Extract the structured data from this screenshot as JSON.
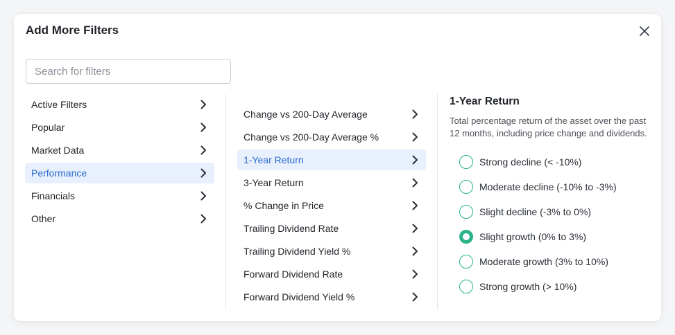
{
  "dialog": {
    "title": "Add More Filters",
    "search_placeholder": "Search for filters"
  },
  "categories": [
    {
      "label": "Active Filters",
      "selected": false
    },
    {
      "label": "Popular",
      "selected": false
    },
    {
      "label": "Market Data",
      "selected": false
    },
    {
      "label": "Performance",
      "selected": true
    },
    {
      "label": "Financials",
      "selected": false
    },
    {
      "label": "Other",
      "selected": false
    }
  ],
  "filters": [
    {
      "label": "Change vs 200-Day Average",
      "selected": false
    },
    {
      "label": "Change vs 200-Day Average %",
      "selected": false
    },
    {
      "label": "1-Year Return",
      "selected": true
    },
    {
      "label": "3-Year Return",
      "selected": false
    },
    {
      "label": "% Change in Price",
      "selected": false
    },
    {
      "label": "Trailing Dividend Rate",
      "selected": false
    },
    {
      "label": "Trailing Dividend Yield %",
      "selected": false
    },
    {
      "label": "Forward Dividend Rate",
      "selected": false
    },
    {
      "label": "Forward Dividend Yield %",
      "selected": false
    }
  ],
  "detail": {
    "title": "1-Year Return",
    "description": "Total percentage return of the asset over the past 12 months, including price change and dividends.",
    "options": [
      {
        "label": "Strong decline (< -10%)",
        "checked": false
      },
      {
        "label": "Moderate decline (-10% to -3%)",
        "checked": false
      },
      {
        "label": "Slight decline (-3% to 0%)",
        "checked": false
      },
      {
        "label": "Slight growth (0% to 3%)",
        "checked": true
      },
      {
        "label": "Moderate growth (3% to 10%)",
        "checked": false
      },
      {
        "label": "Strong growth (> 10%)",
        "checked": false
      }
    ]
  },
  "colors": {
    "accent_blue": "#2c6bcf",
    "selected_bg": "#e8f0fd",
    "radio_green": "#2bb38a"
  },
  "icons": {
    "close": "close-icon",
    "chevron": "chevron-right-icon"
  }
}
